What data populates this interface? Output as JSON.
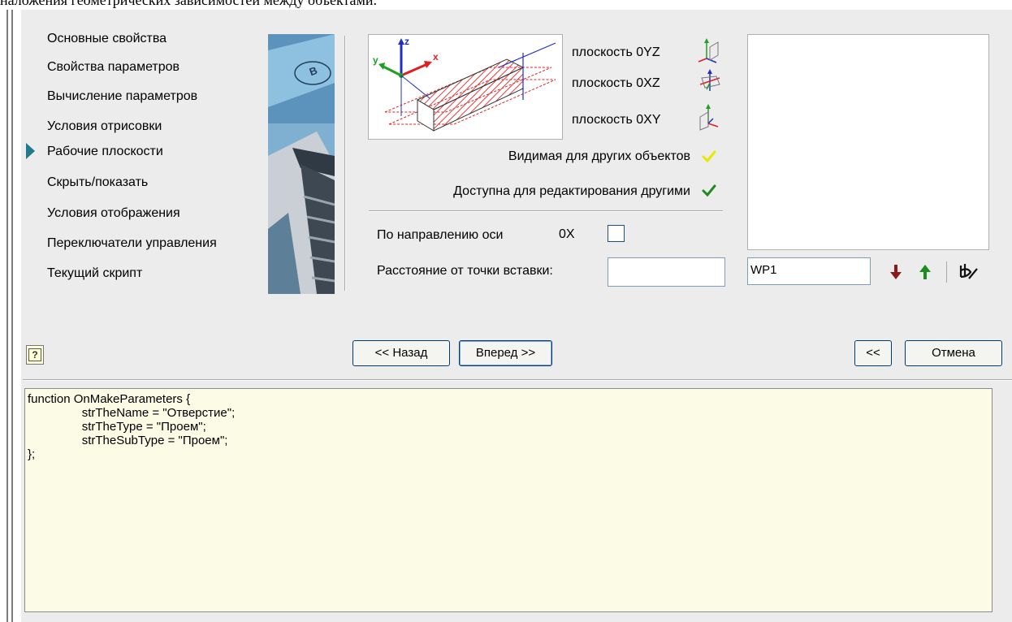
{
  "caption": "наложения геометрических зависимостей между объектами.",
  "nav": {
    "items": [
      "Основные свойства",
      "Свойства параметров",
      "Вычисление параметров",
      "Условия отрисовки",
      "Рабочие плоскости",
      "Скрыть/показать",
      "Условия отображения",
      "Переключатели управления",
      "Текущий скрипт"
    ],
    "active_index": 4,
    "photo_marker": "B"
  },
  "preview": {
    "axis_x": "x",
    "axis_y": "y",
    "axis_z": "z"
  },
  "planes": {
    "oyz_label": "плоскость 0YZ",
    "oxz_label": "плоскость 0XZ",
    "oxy_label": "плоскость 0XY"
  },
  "options": {
    "visible_label": "Видимая для других объектов",
    "editable_label": "Доступна для редактирования другими",
    "direction_label": "По направлению оси",
    "direction_axis": "0X",
    "direction_checked": false,
    "distance_label": "Расстояние от точки вставки:",
    "distance_value": ""
  },
  "workplane": {
    "name_value": "WP1"
  },
  "buttons": {
    "back": "<< Назад",
    "forward": "Вперед >>",
    "collapse": "<<",
    "cancel": "Отмена",
    "help": "?"
  },
  "script": {
    "text": "function OnMakeParameters {\n\t\tstrTheName = \"Отверстие\";\n\t\tstrTheType = \"Проем\";\n\t\tstrTheSubType = \"Проем\";\n};"
  },
  "colors": {
    "dialog_bg": "#ececec",
    "nav_arrow": "#1f7a8c",
    "code_bg": "#fcfce6",
    "arrow_down": "#8b1a1a",
    "arrow_up": "#1e8b1e",
    "check_visible": "#e8e800",
    "check_editable": "#1e8b1e"
  }
}
